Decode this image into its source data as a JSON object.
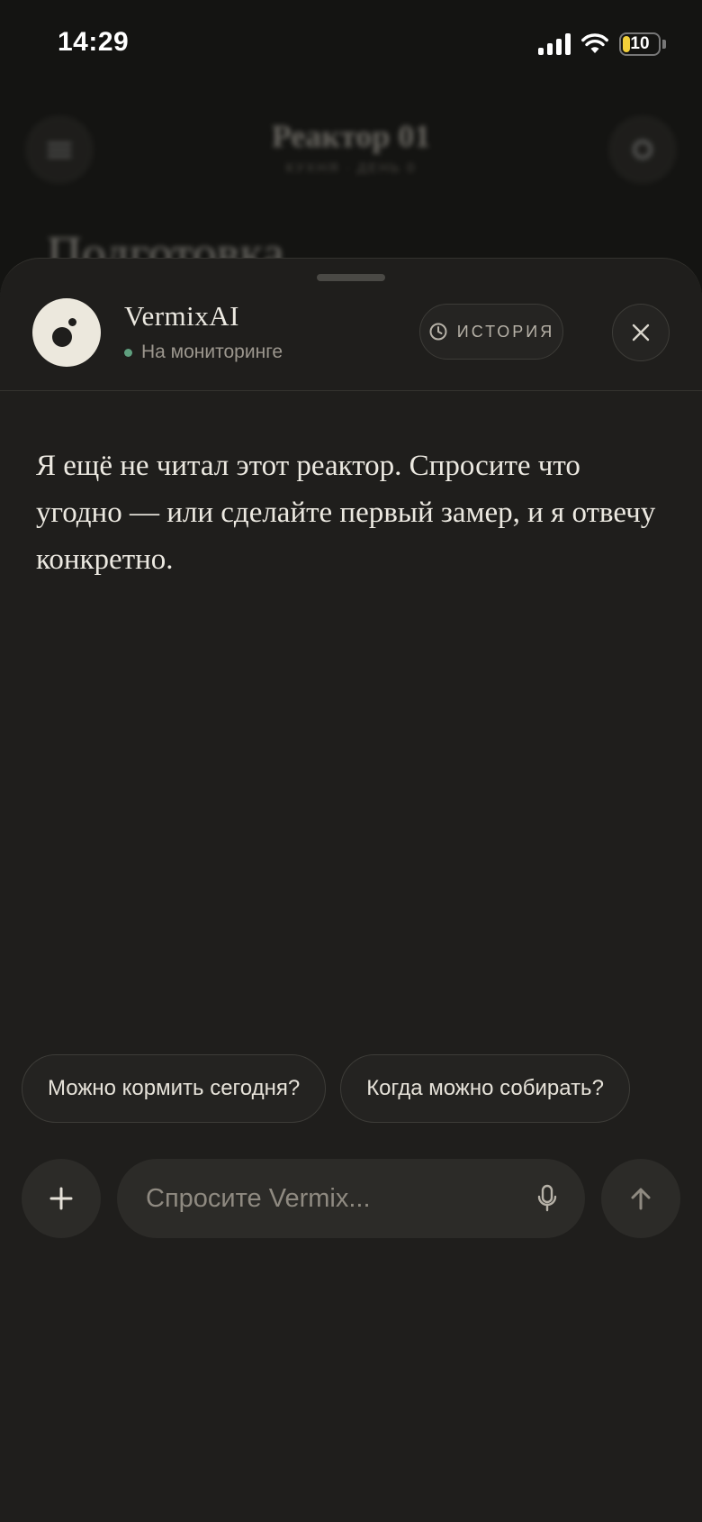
{
  "status_bar": {
    "time": "14:29",
    "battery": "10"
  },
  "background": {
    "title": "Реактор 01",
    "subtitle": "КУХНЯ · ДЕНЬ 0",
    "heading": "Подготовка"
  },
  "agent": {
    "name": "VermixAI",
    "status": "На мониторинге"
  },
  "header": {
    "history_label": "ИСТОРИЯ"
  },
  "message": {
    "text": "Я ещё не читал этот реактор. Спросите что угодно — или сделайте первый замер, и я отвечу конкретно."
  },
  "suggestions": [
    "Можно кормить сегодня?",
    "Когда можно собирать?"
  ],
  "composer": {
    "placeholder": "Спросите Vermix..."
  },
  "colors": {
    "sheet": "#1f1e1c",
    "accent_online": "#5f9f7e",
    "battery_fill": "#f2cf3a"
  },
  "icons": {
    "plus": "plus-icon",
    "mic": "mic-icon",
    "send": "arrow-up-icon",
    "history": "clock-icon",
    "close": "close-icon"
  }
}
